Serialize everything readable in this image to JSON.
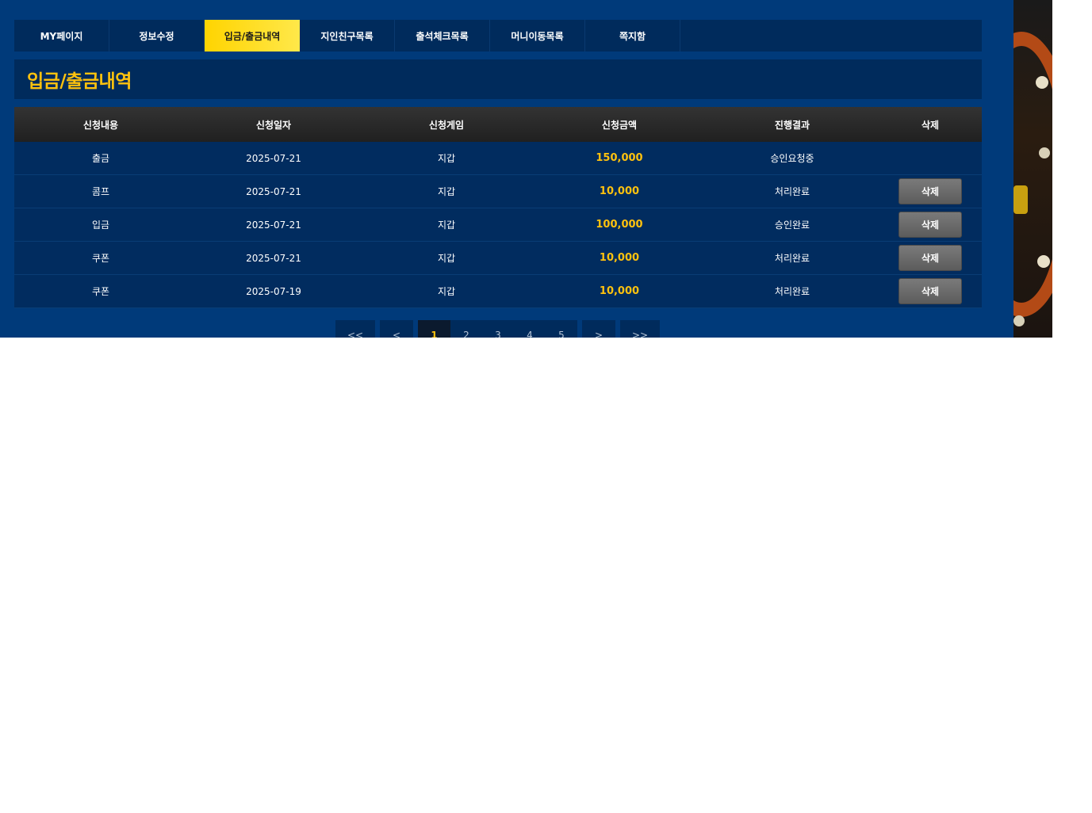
{
  "tabs": [
    {
      "label": "MY페이지",
      "active": false
    },
    {
      "label": "정보수정",
      "active": false
    },
    {
      "label": "입금/출금내역",
      "active": true
    },
    {
      "label": "지인친구목록",
      "active": false
    },
    {
      "label": "출석체크목록",
      "active": false
    },
    {
      "label": "머니이동목록",
      "active": false
    },
    {
      "label": "쪽지함",
      "active": false
    }
  ],
  "page_title": "입금/출금내역",
  "table": {
    "headers": [
      "신청내용",
      "신청일자",
      "신청게임",
      "신청금액",
      "진행결과",
      "삭제"
    ],
    "rows": [
      {
        "type": "출금",
        "date": "2025-07-21",
        "game": "지갑",
        "amount": "150,000",
        "status": "승인요청중",
        "delete": ""
      },
      {
        "type": "콤프",
        "date": "2025-07-21",
        "game": "지갑",
        "amount": "10,000",
        "status": "처리완료",
        "delete": "삭제"
      },
      {
        "type": "입금",
        "date": "2025-07-21",
        "game": "지갑",
        "amount": "100,000",
        "status": "승인완료",
        "delete": "삭제"
      },
      {
        "type": "쿠폰",
        "date": "2025-07-21",
        "game": "지갑",
        "amount": "10,000",
        "status": "처리완료",
        "delete": "삭제"
      },
      {
        "type": "쿠폰",
        "date": "2025-07-19",
        "game": "지갑",
        "amount": "10,000",
        "status": "처리완료",
        "delete": "삭제"
      }
    ]
  },
  "pagination": {
    "first": "<<",
    "prev": "<",
    "pages": [
      "1",
      "2",
      "3",
      "4",
      "5"
    ],
    "current": "1",
    "next": ">",
    "last": ">>"
  },
  "colors": {
    "panel_bg": "#003a7a",
    "box_bg": "#002b5c",
    "accent_yellow": "#ffc20e",
    "active_tab": "#ffd400"
  }
}
